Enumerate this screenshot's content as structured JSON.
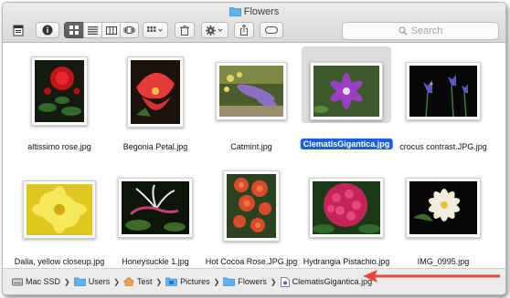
{
  "window": {
    "title": "Flowers"
  },
  "toolbar": {
    "search_placeholder": "Search",
    "buttons": [
      "sidebar-toggle",
      "info",
      "view-icon",
      "view-list",
      "view-columns",
      "view-cover-flow",
      "arrange",
      "delete",
      "action",
      "share",
      "tag"
    ]
  },
  "files": [
    {
      "name": "altissimo rose.jpg",
      "selected": false
    },
    {
      "name": "Begonia Petal.jpg",
      "selected": false
    },
    {
      "name": "Catmint.jpg",
      "selected": false
    },
    {
      "name": "ClematisGigantica.jpg",
      "selected": true
    },
    {
      "name": "crocus contrast.JPG.jpg",
      "selected": false
    },
    {
      "name": "Dalia, yellow closeup.jpg",
      "selected": false
    },
    {
      "name": "Honeysuckle 1.jpg",
      "selected": false
    },
    {
      "name": "Hot Cocoa Rose.JPG.jpg",
      "selected": false
    },
    {
      "name": "Hydrangia Pistachio.jpg",
      "selected": false
    },
    {
      "name": "IMG_0995.jpg",
      "selected": false
    }
  ],
  "pathbar": {
    "crumbs": [
      {
        "label": "Mac SSD",
        "icon": "hard-drive-icon"
      },
      {
        "label": "Users",
        "icon": "folder-icon"
      },
      {
        "label": "Test",
        "icon": "home-icon"
      },
      {
        "label": "Pictures",
        "icon": "pictures-folder-icon"
      },
      {
        "label": "Flowers",
        "icon": "folder-icon"
      },
      {
        "label": "ClematisGigantica.jpg",
        "icon": "image-file-icon"
      }
    ]
  },
  "colors": {
    "selection": "#1b5ee2",
    "arrow": "#e8473a",
    "folder": "#5fb1ef"
  }
}
